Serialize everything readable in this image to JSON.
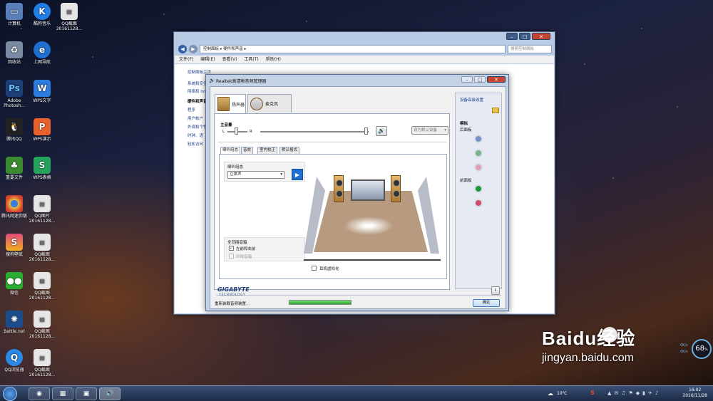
{
  "desktop_icons": [
    {
      "label": "计算机",
      "icon": "computer-icon",
      "color": "#5a7fb8"
    },
    {
      "label": "回收站",
      "icon": "recycle-bin-icon",
      "color": "#7a8ca4"
    },
    {
      "label": "Adobe Photosh...",
      "icon": "photoshop-icon",
      "color": "#1d3f7a"
    },
    {
      "label": "腾讯QQ",
      "icon": "qq-icon",
      "color": "#222"
    },
    {
      "label": "重要文件",
      "icon": "tree-icon",
      "color": "#3a8a30"
    },
    {
      "label": "腾讯网迷你版",
      "icon": "chrome-icon",
      "color": "#dcd2c0"
    },
    {
      "label": "搜狗壁纸",
      "icon": "sogou-wallpaper-icon",
      "color": "#e04a7c"
    },
    {
      "label": "微信",
      "icon": "wechat-icon",
      "color": "#2aae32"
    },
    {
      "label": "Battle.net",
      "icon": "battlenet-icon",
      "color": "#1b4d8c"
    },
    {
      "label": "QQ浏览器",
      "icon": "qq-browser-icon",
      "color": "#2b8ae6"
    },
    {
      "label": "酷狗音乐",
      "icon": "kugou-icon",
      "color": "#1f7fe8"
    },
    {
      "label": "上网导航",
      "icon": "ie-icon",
      "color": "#1e6fd0"
    },
    {
      "label": "WPS文字",
      "icon": "wps-writer-icon",
      "color": "#2c7ce0"
    },
    {
      "label": "WPS演示",
      "icon": "wps-presentation-icon",
      "color": "#e8612c"
    },
    {
      "label": "WPS表格",
      "icon": "wps-spreadsheet-icon",
      "color": "#24a35a"
    },
    {
      "label": "QQ图片20161128...",
      "icon": "image-file-icon",
      "color": "#e6e6e6"
    },
    {
      "label": "QQ截图20161128...",
      "icon": "image-file-icon",
      "color": "#e6e6e6"
    },
    {
      "label": "QQ截图20161128...",
      "icon": "image-file-icon",
      "color": "#e6e6e6"
    },
    {
      "label": "QQ截图20161128...",
      "icon": "image-file-icon",
      "color": "#e6e6e6"
    },
    {
      "label": "QQ截图20161128...",
      "icon": "image-file-icon",
      "color": "#e6e6e6"
    },
    {
      "label": "QQ截图20161128...",
      "icon": "image-file-icon",
      "color": "#e6e6e6"
    }
  ],
  "explorer": {
    "address": "控制面板 ▸ 硬件和声音 ▸",
    "search_placeholder": "搜索控制面板",
    "menu": [
      "文件(F)",
      "编辑(E)",
      "查看(V)",
      "工具(T)",
      "帮助(H)"
    ],
    "nav_links": [
      "控制面板主页",
      "系统和安全",
      "网络和 Int",
      "硬件和声音",
      "程序",
      "用户帐户",
      "外观和个性",
      "时钟、语",
      "轻松访问"
    ]
  },
  "dialog": {
    "title": "Realtek高清晰音频管理器",
    "tabs": [
      "扬声器",
      "麦克风"
    ],
    "main_volume_label": "主音量",
    "left": "L",
    "right": "R",
    "default_device_btn": "设为默认设备",
    "subtabs": [
      "喇叭组态",
      "音效",
      "室内校正",
      "默认格式"
    ],
    "speaker_config_label": "喇叭组态",
    "speaker_config_value": "立体声",
    "fullrange_label": "全范围音箱",
    "front_lr_label": "左前和右前",
    "surround_label": "环绕音箱",
    "headphone_virtual_label": "耳机虚拟化",
    "device_adv_label": "设备高级设置",
    "analog_label": "模拟",
    "back_panel_label": "后面板",
    "front_panel_label": "前面板",
    "brand": "GIGABYTE",
    "brand_sub": "TECHNOLOGY",
    "status_text": "重新装载音频装置...",
    "ok_btn": "确定",
    "info_btn": "i"
  },
  "taskbar": {
    "weather": "10℃",
    "time": "16:02",
    "date": "2016/11/28"
  },
  "gauge": {
    "value": "68",
    "unit": "%",
    "up": "0K/s",
    "down": "0K/s"
  },
  "watermark": {
    "brand": "Baidu经验",
    "url": "jingyan.baidu.com"
  }
}
